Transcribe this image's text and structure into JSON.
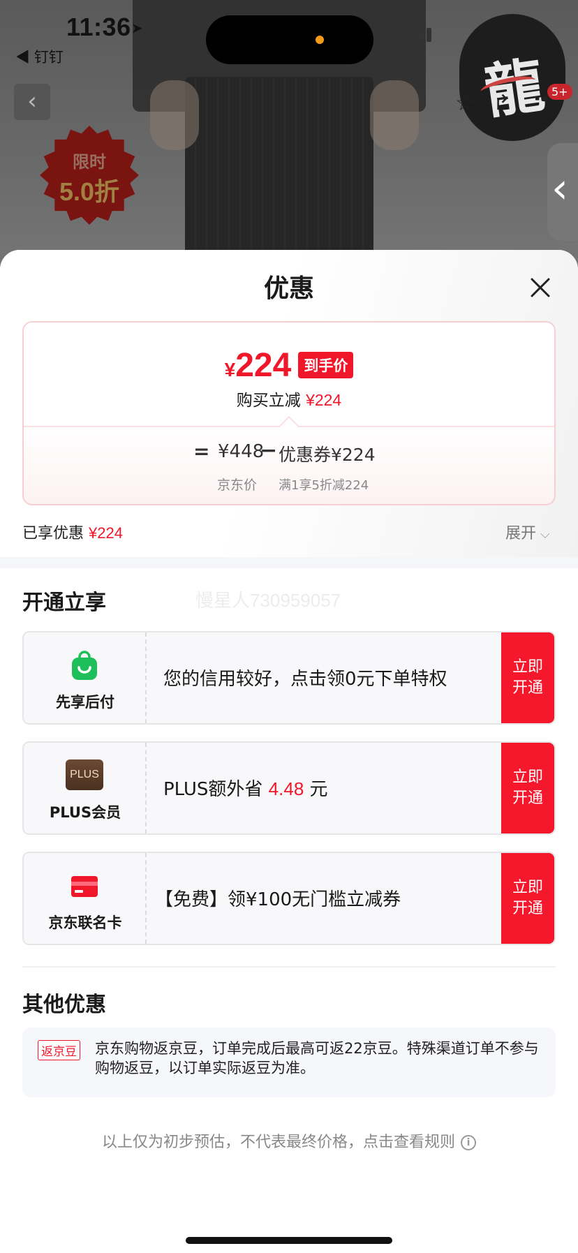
{
  "status": {
    "time": "11:36",
    "back_app": "◀ 钉钉"
  },
  "product": {
    "badge_line1": "限时",
    "badge_line2": "5.0折"
  },
  "top_actions": {
    "more_badge": "5+"
  },
  "sheet": {
    "title": "优惠",
    "price": {
      "currency": "¥",
      "value": "224",
      "tag": "到手价",
      "reduce_label": "购买立减",
      "reduce_value": "¥224",
      "calc_eq": "=",
      "calc_jd_price": "¥448",
      "calc_minus": "−",
      "calc_coupon": "优惠券¥224",
      "sub_jd": "京东价",
      "sub_coupon": "满1享5折减224"
    },
    "enjoyed_label": "已享优惠",
    "enjoyed_value": "¥224",
    "expand_label": "展开"
  },
  "open_section": {
    "title": "开通立享",
    "watermark": "慢星人730959057",
    "cards": [
      {
        "name": "先享后付",
        "icon": "shopping-bag-icon",
        "text": "您的信用较好，点击领0元下单特权",
        "button": "立即\n开通"
      },
      {
        "name": "PLUS会员",
        "icon": "plus-badge-icon",
        "icon_text": "PLUS",
        "text_prefix": "PLUS额外省",
        "text_value": "4.48",
        "text_suffix": "元",
        "button": "立即\n开通"
      },
      {
        "name": "京东联名卡",
        "icon": "credit-card-icon",
        "text": "【免费】领¥100无门槛立减券",
        "button": "立即\n开通"
      }
    ]
  },
  "other_section": {
    "title": "其他优惠",
    "tag": "返京豆",
    "text": "京东购物返京豆，订单完成后最高可返22京豆。特殊渠道订单不参与购物返豆，以订单实际返豆为准。"
  },
  "disclaimer": "以上仅为初步预估，不代表最终价格，点击查看规则",
  "colors": {
    "accent": "#f0172a",
    "button": "#f5172c",
    "green": "#1dbf5a",
    "plus_brown": "#5a3d2b"
  }
}
